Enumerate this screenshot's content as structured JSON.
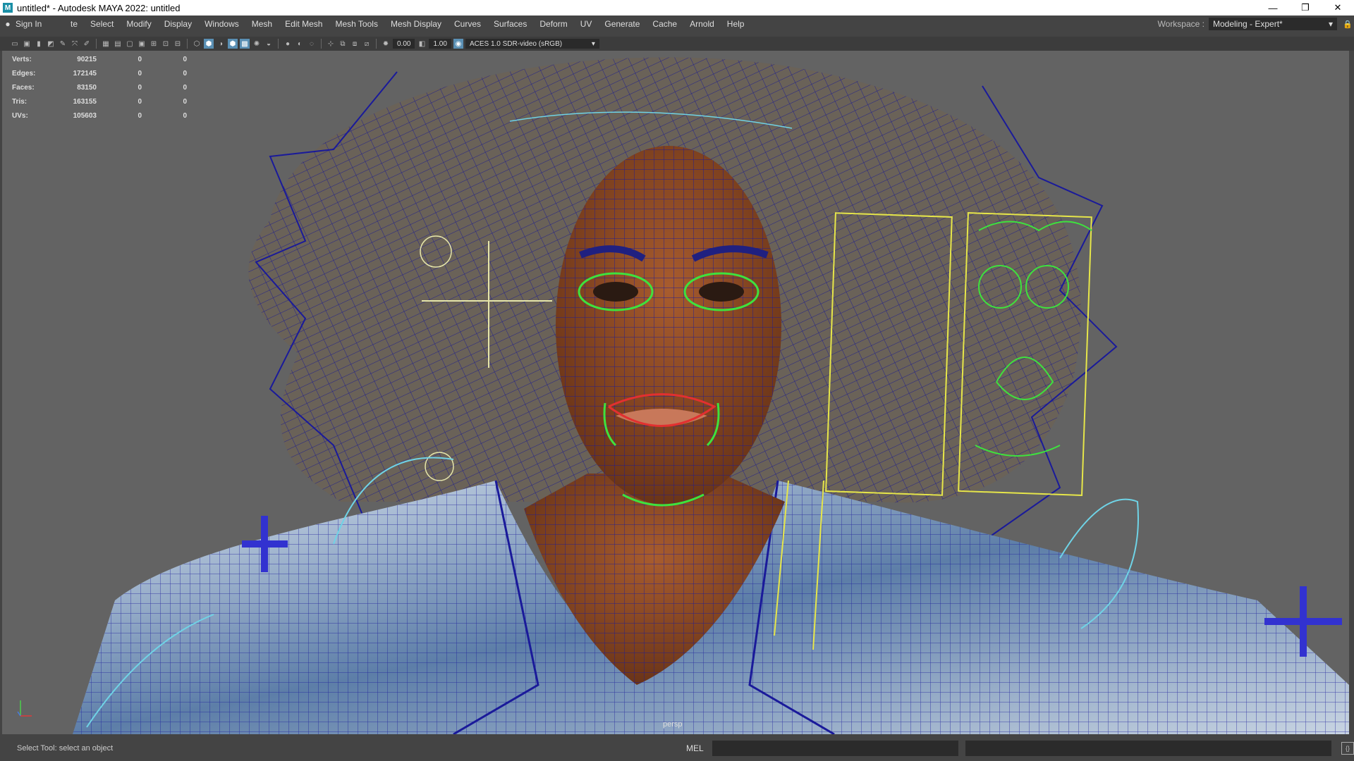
{
  "window": {
    "title": "untitled* - Autodesk MAYA 2022: untitled",
    "app_icon": "M",
    "minimize": "—",
    "restore": "❐",
    "close": "✕"
  },
  "menubar": {
    "signin_label": "Sign In",
    "items": [
      "te",
      "Select",
      "Modify",
      "Display",
      "Windows",
      "Mesh",
      "Edit Mesh",
      "Mesh Tools",
      "Mesh Display",
      "Curves",
      "Surfaces",
      "Deform",
      "UV",
      "Generate",
      "Cache",
      "Arnold",
      "Help"
    ]
  },
  "workspace": {
    "label": "Workspace :",
    "value": "Modeling - Expert*"
  },
  "toolbar": {
    "exposure": "0.00",
    "gamma": "1.00",
    "color_space": "ACES 1.0 SDR-video (sRGB)"
  },
  "hud": {
    "rows": [
      {
        "label": "Verts:",
        "v1": "90215",
        "v2": "0",
        "v3": "0"
      },
      {
        "label": "Edges:",
        "v1": "172145",
        "v2": "0",
        "v3": "0"
      },
      {
        "label": "Faces:",
        "v1": "83150",
        "v2": "0",
        "v3": "0"
      },
      {
        "label": "Tris:",
        "v1": "163155",
        "v2": "0",
        "v3": "0"
      },
      {
        "label": "UVs:",
        "v1": "105603",
        "v2": "0",
        "v3": "0"
      }
    ]
  },
  "viewport": {
    "camera_label": "persp"
  },
  "statusbar": {
    "help_line": "Select Tool: select an object",
    "script_type": "MEL"
  },
  "colors": {
    "wire": "#1a1a9a",
    "skin": "#8b4a24",
    "control_green": "#3ee23e",
    "control_yellow": "#e6e64a",
    "control_cyan": "#6fd3e6"
  }
}
